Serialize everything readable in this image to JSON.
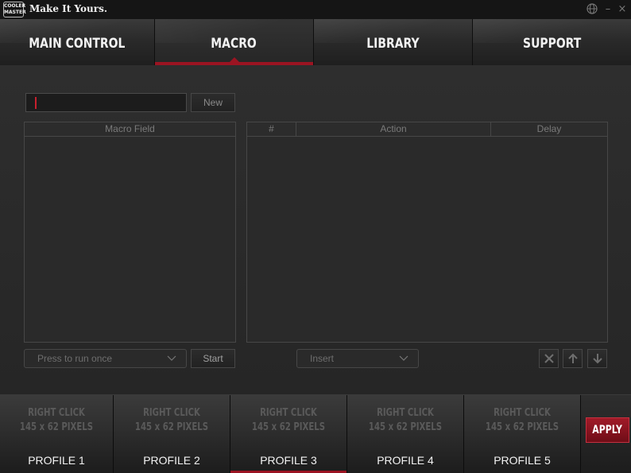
{
  "titlebar": {
    "logo_line1": "COOLER",
    "logo_line2": "MASTER",
    "tagline": "Make It Yours.",
    "globe_icon": "globe-icon",
    "minimize_glyph": "–",
    "close_glyph": "×"
  },
  "nav": {
    "tabs": [
      {
        "label": "MAIN CONTROL",
        "active": false
      },
      {
        "label": "MACRO",
        "active": true
      },
      {
        "label": "LIBRARY",
        "active": false
      },
      {
        "label": "SUPPORT",
        "active": false
      }
    ]
  },
  "macro": {
    "name_value": "",
    "new_label": "New",
    "macro_field_header": "Macro Field",
    "table_headers": {
      "num": "#",
      "action": "Action",
      "delay": "Delay"
    },
    "run_mode_selected": "Press to run once",
    "start_label": "Start",
    "insert_selected": "Insert"
  },
  "profiles": {
    "items": [
      {
        "placeholder1": "RIGHT CLICK",
        "placeholder2": "145 x 62 PIXELS",
        "name": "PROFILE 1",
        "active": false
      },
      {
        "placeholder1": "RIGHT CLICK",
        "placeholder2": "145 x 62 PIXELS",
        "name": "PROFILE 2",
        "active": false
      },
      {
        "placeholder1": "RIGHT CLICK",
        "placeholder2": "145 x 62 PIXELS",
        "name": "PROFILE 3",
        "active": true
      },
      {
        "placeholder1": "RIGHT CLICK",
        "placeholder2": "145 x 62 PIXELS",
        "name": "PROFILE 4",
        "active": false
      },
      {
        "placeholder1": "RIGHT CLICK",
        "placeholder2": "145 x 62 PIXELS",
        "name": "PROFILE 5",
        "active": false
      }
    ],
    "apply_label": "APPLY"
  },
  "colors": {
    "accent": "#9b1422",
    "background": "#262626"
  }
}
